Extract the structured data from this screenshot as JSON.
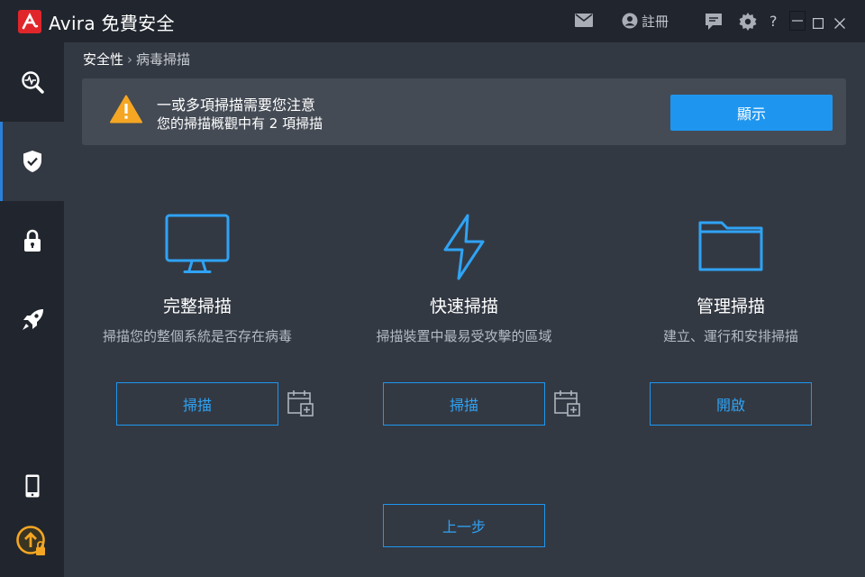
{
  "titlebar": {
    "app_title": "Avira 免費安全",
    "register_label": "註冊",
    "help_label": "?",
    "icons": [
      "mail-icon",
      "user-icon",
      "feedback-icon",
      "gear-icon",
      "help-icon",
      "minimize-icon",
      "maximize-icon",
      "close-icon"
    ]
  },
  "sidebar": {
    "items": [
      {
        "name": "status",
        "icon": "pulse-magnifier-icon",
        "active": false
      },
      {
        "name": "security",
        "icon": "shield-check-icon",
        "active": true
      },
      {
        "name": "privacy",
        "icon": "padlock-icon",
        "active": false
      },
      {
        "name": "performance",
        "icon": "rocket-icon",
        "active": false
      },
      {
        "name": "mobile",
        "icon": "smartphone-icon",
        "active": false
      },
      {
        "name": "upgrade",
        "icon": "upgrade-arrow-icon",
        "active": false
      }
    ]
  },
  "breadcrumb": {
    "parent": "安全性",
    "separator": "›",
    "current": "病毒掃描"
  },
  "alert": {
    "title": "一或多項掃描需要您注意",
    "subtitle": "您的掃描概觀中有 2 項掃描",
    "button_label": "顯示"
  },
  "cards": [
    {
      "icon": "monitor-icon",
      "title": "完整掃描",
      "description": "掃描您的整個系統是否存在病毒",
      "button_label": "掃描",
      "has_schedule": true
    },
    {
      "icon": "lightning-icon",
      "title": "快速掃描",
      "description": "掃描裝置中最易受攻擊的區域",
      "button_label": "掃描",
      "has_schedule": true
    },
    {
      "icon": "folder-icon",
      "title": "管理掃描",
      "description": "建立、運行和安排掃描",
      "button_label": "開啟",
      "has_schedule": false
    }
  ],
  "back_button_label": "上一步",
  "colors": {
    "accent": "#1e96f0",
    "brand_red": "#e0262b",
    "warning": "#f5a623",
    "sidebar_bg": "#21262e",
    "main_bg": "#333943"
  }
}
